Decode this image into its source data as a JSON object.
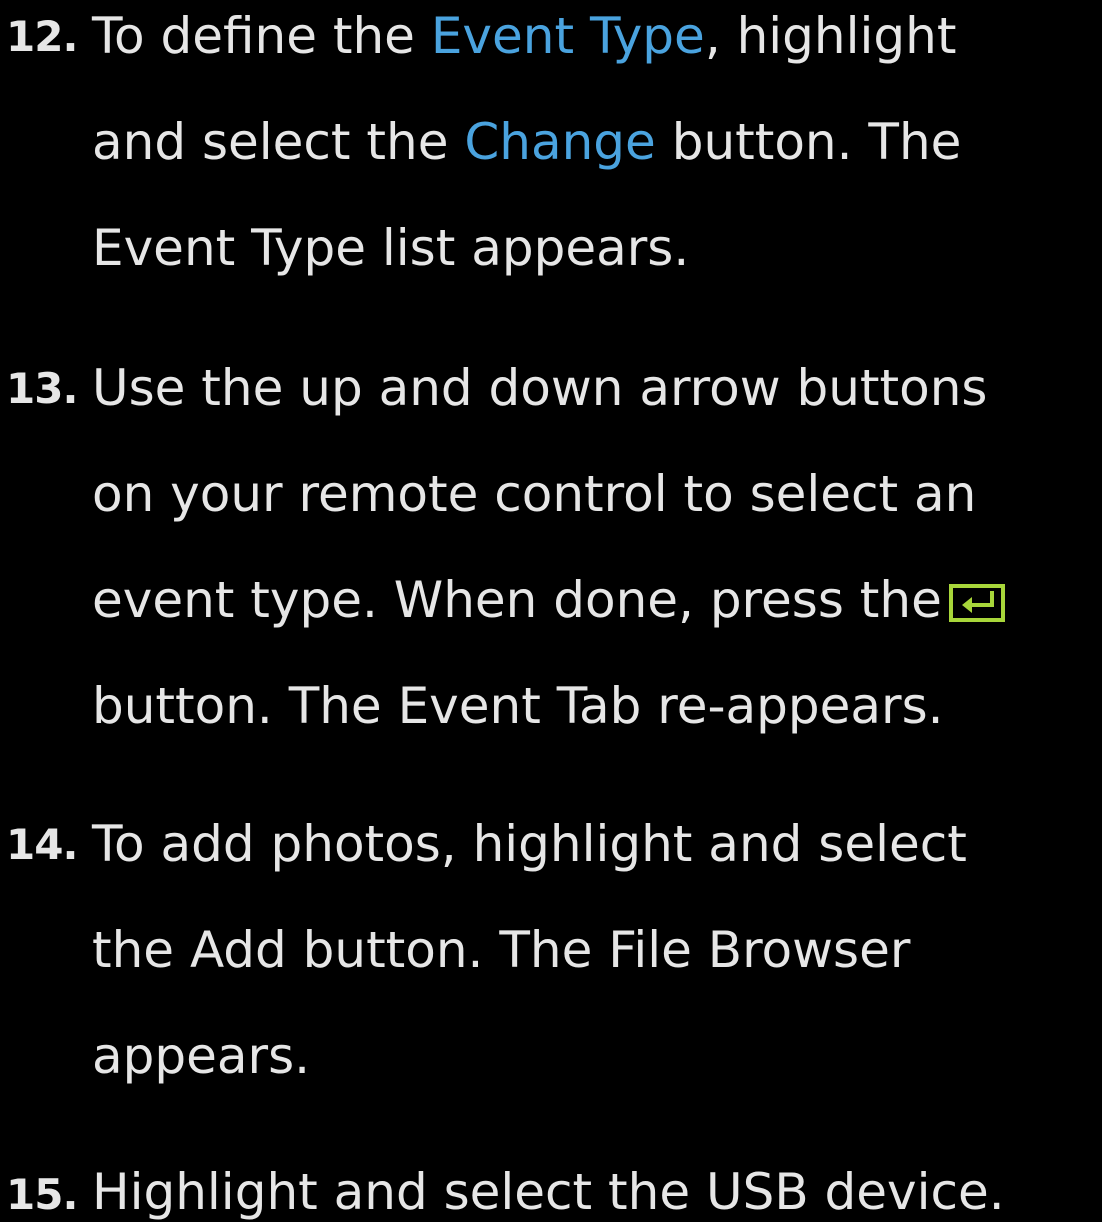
{
  "colors": {
    "background": "#000000",
    "text": "#e6e6e6",
    "highlight": "#4aa3df",
    "enter_icon": "#a8d63a"
  },
  "steps": [
    {
      "number": "12.",
      "lines": {
        "l1_pre": "To define the ",
        "l1_hl": "Event Type",
        "l1_post": ", highlight",
        "l2_pre": "and select the ",
        "l2_hl": "Change",
        "l2_post": " button. The",
        "l3": "Event Type list appears."
      }
    },
    {
      "number": "13.",
      "lines": {
        "l1": "Use the up and down arrow buttons",
        "l2": "on your remote control to select an",
        "l3": "event type. When done, press the",
        "l4": "button. The Event Tab re-appears."
      },
      "icon": "enter-icon"
    },
    {
      "number": "14.",
      "lines": {
        "l1": "To add photos, highlight and select",
        "l2": "the Add button. The File Browser",
        "l3": "appears."
      }
    },
    {
      "number": "15.",
      "lines": {
        "l1": "Highlight and select the USB device."
      }
    }
  ]
}
